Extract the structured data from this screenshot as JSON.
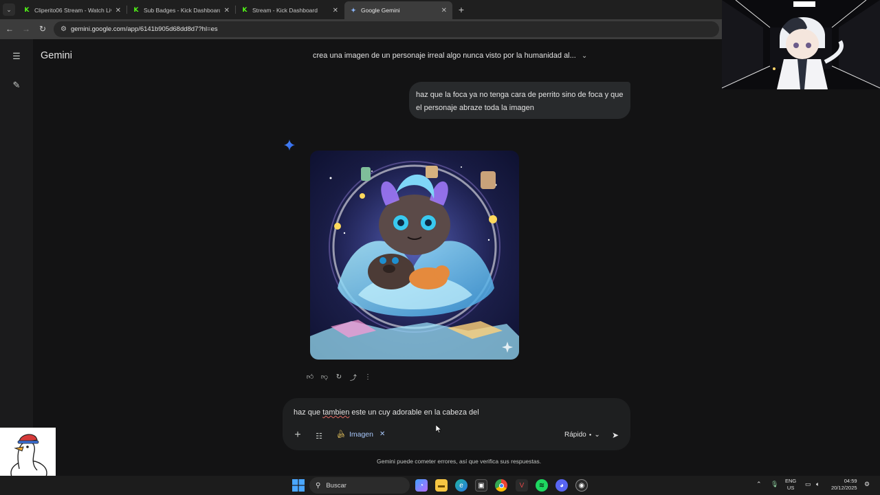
{
  "browser": {
    "tabs": [
      {
        "label": "Cliperito06 Stream - Watch Live",
        "favicon": "kick-icon"
      },
      {
        "label": "Sub Badges - Kick Dashboard",
        "favicon": "kick-icon"
      },
      {
        "label": "Stream - Kick Dashboard",
        "favicon": "kick-icon"
      },
      {
        "label": "Google Gemini",
        "favicon": "gemini-icon",
        "active": true
      }
    ],
    "url": "gemini.google.com/app/6141b905d68dd8d7?hl=es"
  },
  "gemini": {
    "brand": "Gemini",
    "conversation_title": "crea una imagen de un personaje irreal algo nunca visto por la humanidad al...",
    "user_message": "haz que la foca ya no tenga cara de perrito sino de foca y que el personaje abraze toda la imagen",
    "composer": {
      "prompt_before": "haz que ",
      "prompt_misspelled": "tambien",
      "prompt_after": " este un cuy adorable en la cabeza del",
      "tool_chip": "Imagen",
      "model_label": "Rápido"
    },
    "disclaimer": "Gemini puede cometer errores, así que verifica sus respuestas."
  },
  "taskbar": {
    "search_label": "Buscar",
    "lang_line1": "ENG",
    "lang_line2": "US",
    "time": "04:59",
    "date": "20/12/2025"
  },
  "colors": {
    "app_bg": "#131314",
    "bubble_bg": "#282a2c",
    "composer_bg": "#1e1f20",
    "accent": "#a8c7fa",
    "kick_green": "#53fc18"
  }
}
